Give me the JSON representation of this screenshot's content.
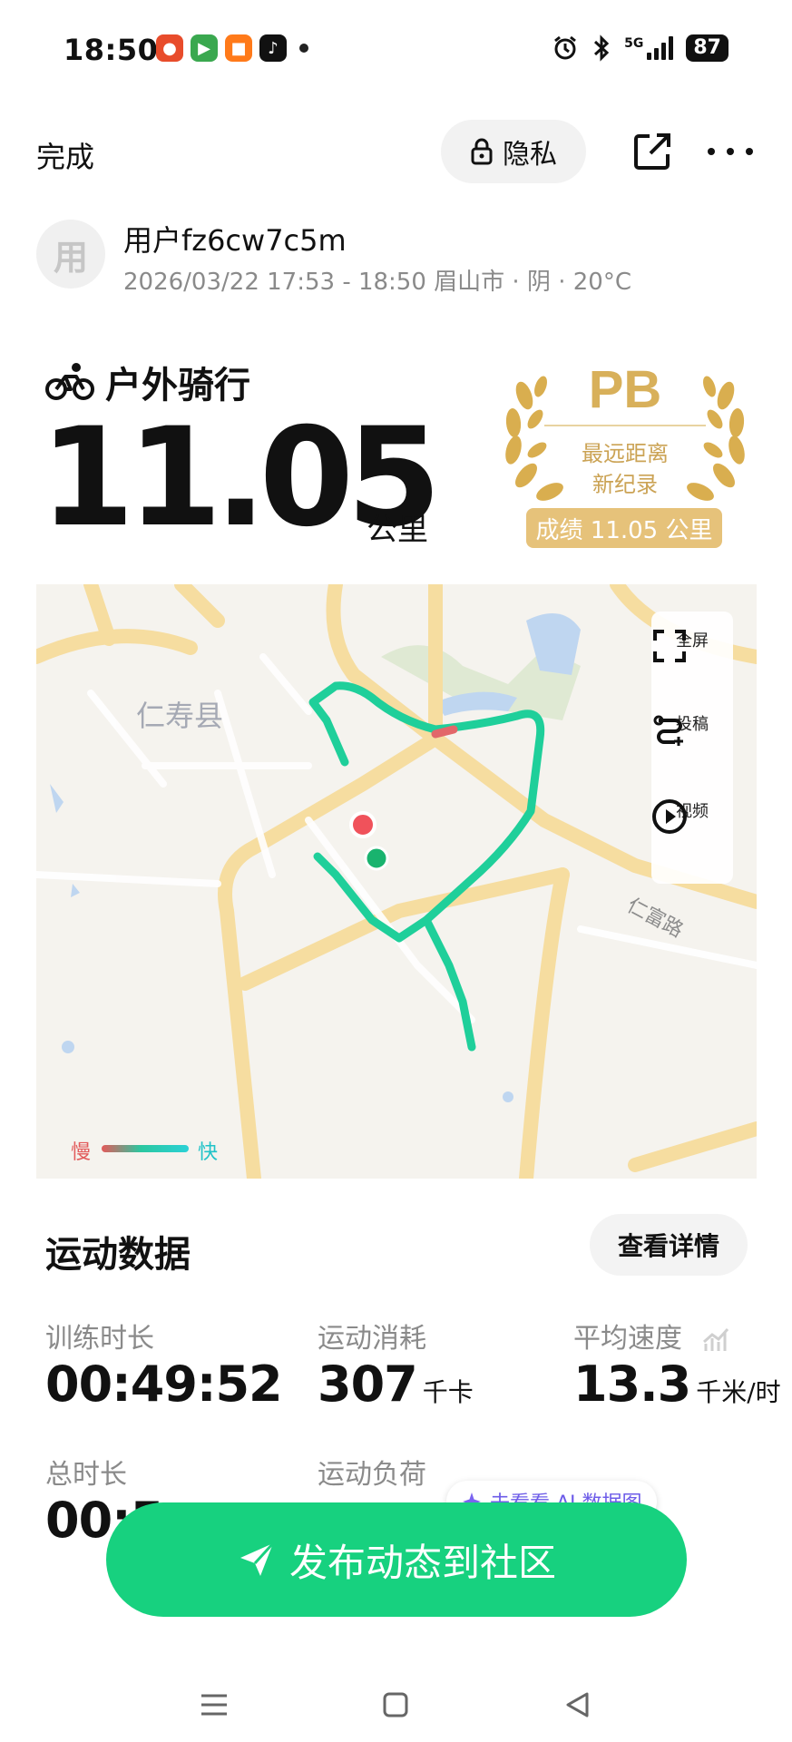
{
  "status_bar": {
    "time": "18:50",
    "network": "5G",
    "battery": "87",
    "icons": [
      "alarm-icon",
      "bluetooth-icon",
      "signal-icon",
      "battery-icon"
    ]
  },
  "nav": {
    "done": "完成",
    "privacy": "隐私"
  },
  "user": {
    "avatar_text": "用",
    "name": "用户fz6cw7c5m",
    "meta": "2026/03/22 17:53 - 18:50 眉山市 · 阴 · 20°C"
  },
  "activity": {
    "type": "户外骑行",
    "distance": "11.05",
    "unit": "公里"
  },
  "pb": {
    "title": "PB",
    "desc_line1": "最远距离",
    "desc_line2": "新纪录",
    "record": "成绩 11.05 公里",
    "color": "#e6c27a"
  },
  "map": {
    "place": "仁寿县",
    "road": "仁富路",
    "controls": {
      "fullscreen": "全屏",
      "submit": "投稿",
      "video": "视频"
    },
    "legend": {
      "slow": "慢",
      "fast": "快"
    },
    "route_color": "#1fcf9a",
    "start_color": "#19b36e",
    "end_color": "#f0525b"
  },
  "stats": {
    "title": "运动数据",
    "detail_button": "查看详情",
    "training_duration": {
      "label": "训练时长",
      "value": "00:49:52"
    },
    "calories": {
      "label": "运动消耗",
      "value": "307",
      "unit": "千卡"
    },
    "avg_speed": {
      "label": "平均速度",
      "value": "13.3",
      "unit": "千米/时"
    },
    "total_duration": {
      "label": "总时长",
      "value": "00:5"
    },
    "load": {
      "label": "运动负荷"
    }
  },
  "ai_tip": "去看看 AI 数据图",
  "publish_button": "发布动态到社区",
  "accent_color": "#17d17f"
}
